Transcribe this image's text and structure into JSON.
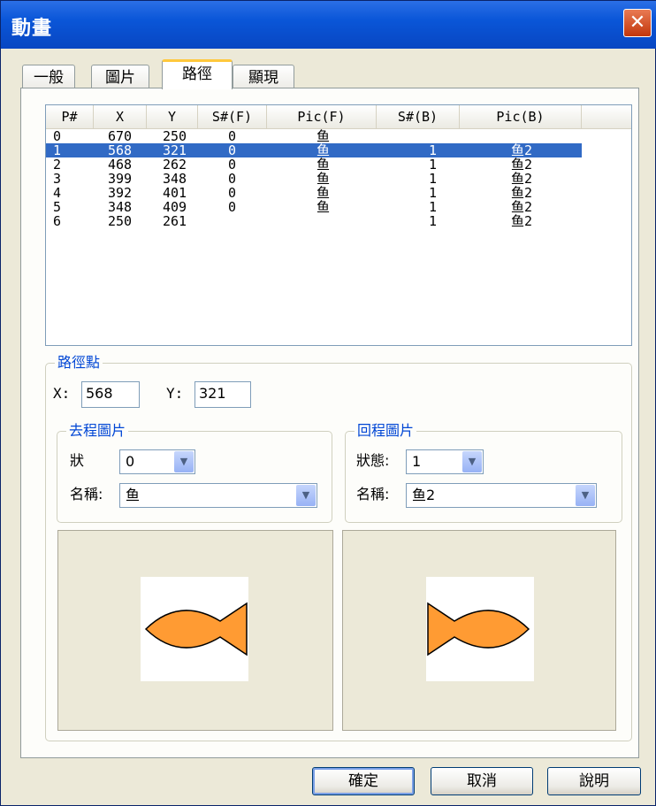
{
  "window": {
    "title": "動畫"
  },
  "tabs": [
    {
      "label": "一般"
    },
    {
      "label": "圖片"
    },
    {
      "label": "路徑"
    },
    {
      "label": "顯現"
    }
  ],
  "list": {
    "headers": [
      "P#",
      "X",
      "Y",
      "S#(F)",
      "Pic(F)",
      "S#(B)",
      "Pic(B)"
    ],
    "rows": [
      [
        "0",
        "670",
        "250",
        "0",
        "鱼",
        "",
        ""
      ],
      [
        "1",
        "568",
        "321",
        "0",
        "鱼",
        "1",
        "鱼2"
      ],
      [
        "2",
        "468",
        "262",
        "0",
        "鱼",
        "1",
        "鱼2"
      ],
      [
        "3",
        "399",
        "348",
        "0",
        "鱼",
        "1",
        "鱼2"
      ],
      [
        "4",
        "392",
        "401",
        "0",
        "鱼",
        "1",
        "鱼2"
      ],
      [
        "5",
        "348",
        "409",
        "0",
        "鱼",
        "1",
        "鱼2"
      ],
      [
        "6",
        "250",
        "261",
        "",
        "",
        "1",
        "鱼2"
      ]
    ],
    "selected_row": 1
  },
  "path_point": {
    "title": "路徑點",
    "x_label": "X:",
    "x_value": "568",
    "y_label": "Y:",
    "y_value": "321"
  },
  "forward": {
    "title": "去程圖片",
    "state_label": "狀",
    "state_value": "0",
    "name_label": "名稱:",
    "name_value": "鱼"
  },
  "backward": {
    "title": "回程圖片",
    "state_label": "狀態:",
    "state_value": "1",
    "name_label": "名稱:",
    "name_value": "鱼2"
  },
  "buttons": {
    "ok": "確定",
    "cancel": "取消",
    "help": "說明"
  },
  "colors": {
    "fish_fill": "#FF9B33",
    "selection": "#316AC5",
    "group_title": "#0046D5"
  }
}
